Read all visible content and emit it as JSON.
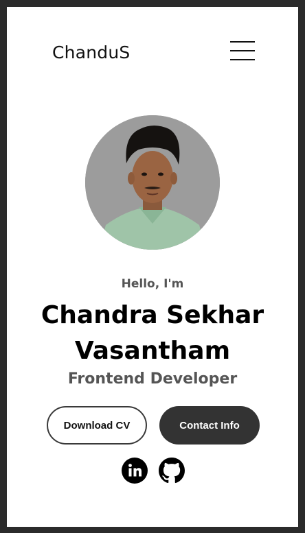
{
  "nav": {
    "brand": "ChanduS",
    "menu_icon": "hamburger-menu-icon"
  },
  "profile": {
    "photo_icon": "profile-photo",
    "greeting": "Hello, I'm",
    "name_line1": "Chandra Sekhar",
    "name_line2": "Vasantham",
    "role": "Frontend Developer"
  },
  "actions": {
    "download_cv": "Download CV",
    "contact_info": "Contact Info"
  },
  "social": [
    {
      "icon": "linkedin-icon"
    },
    {
      "icon": "github-icon"
    }
  ],
  "colors": {
    "background": "#ffffff",
    "frame": "#2b2b2b",
    "primary_button": "#333333",
    "muted_text": "#555555",
    "avatar_backdrop": "#9c9c9c"
  }
}
